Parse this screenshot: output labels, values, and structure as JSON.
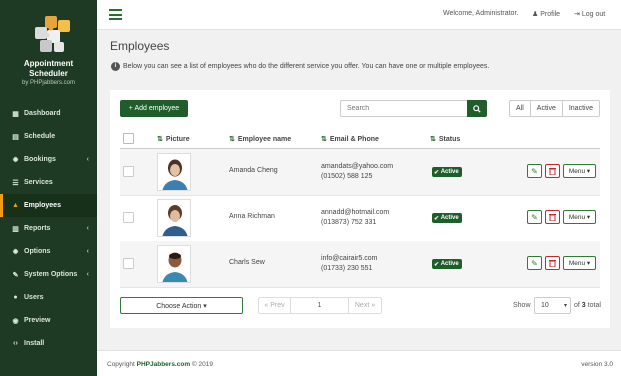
{
  "app": {
    "title_line1": "Appointment",
    "title_line2": "Scheduler",
    "byline": "by PHPjabbers.com"
  },
  "nav": [
    {
      "label": "Dashboard",
      "icon": "grid-icon"
    },
    {
      "label": "Schedule",
      "icon": "calendar-icon"
    },
    {
      "label": "Bookings",
      "icon": "gear-icon",
      "caret": "‹"
    },
    {
      "label": "Services",
      "icon": "list-icon"
    },
    {
      "label": "Employees",
      "icon": "user-icon",
      "active": true
    },
    {
      "label": "Reports",
      "icon": "bar-chart-icon",
      "caret": "‹"
    },
    {
      "label": "Options",
      "icon": "gear-icon",
      "caret": "‹"
    },
    {
      "label": "System Options",
      "icon": "wrench-icon",
      "caret": "‹"
    },
    {
      "label": "Users",
      "icon": "users-icon"
    },
    {
      "label": "Preview",
      "icon": "eye-icon"
    },
    {
      "label": "Install",
      "icon": "code-icon"
    }
  ],
  "topbar": {
    "welcome": "Welcome, Administrator.",
    "profile": "Profile",
    "logout": "Log out"
  },
  "page": {
    "title": "Employees",
    "info": "Below you can see a list of employees who do the different service you offer. You can have one or multiple employees."
  },
  "toolbar": {
    "add_label": "+ Add employee",
    "search_placeholder": "Search",
    "filters": [
      "All",
      "Active",
      "Inactive"
    ]
  },
  "table": {
    "headers": {
      "picture": "Picture",
      "name": "Employee name",
      "email_phone": "Email & Phone",
      "status": "Status"
    },
    "rows": [
      {
        "name": "Amanda Cheng",
        "email": "amandats@yahoo.com",
        "phone": "(01502) 588 125",
        "status": "Active",
        "menu": "Menu"
      },
      {
        "name": "Anna Richman",
        "email": "annadd@hotmail.com",
        "phone": "(013873) 752 331",
        "status": "Active",
        "menu": "Menu"
      },
      {
        "name": "Charls Sew",
        "email": "info@cairair5.com",
        "phone": "(01733) 230 551",
        "status": "Active",
        "menu": "Menu"
      }
    ]
  },
  "bottom": {
    "choose_action": "Choose Action ▾",
    "prev": "« Prev",
    "page": "1",
    "next": "Next »",
    "show_label": "Show",
    "show_value": "10",
    "of_label": "of",
    "total_pages": "3",
    "total_label": "total"
  },
  "footer": {
    "copyright_prefix": "Copyright",
    "brand": "PHPJabbers.com",
    "copyright_suffix": "© 2019",
    "version": "version 3.0"
  },
  "colors": {
    "sidebar": "#1f3a24",
    "accent": "#1f5e2a",
    "active_marker": "#f39c12",
    "danger": "#c62828"
  }
}
